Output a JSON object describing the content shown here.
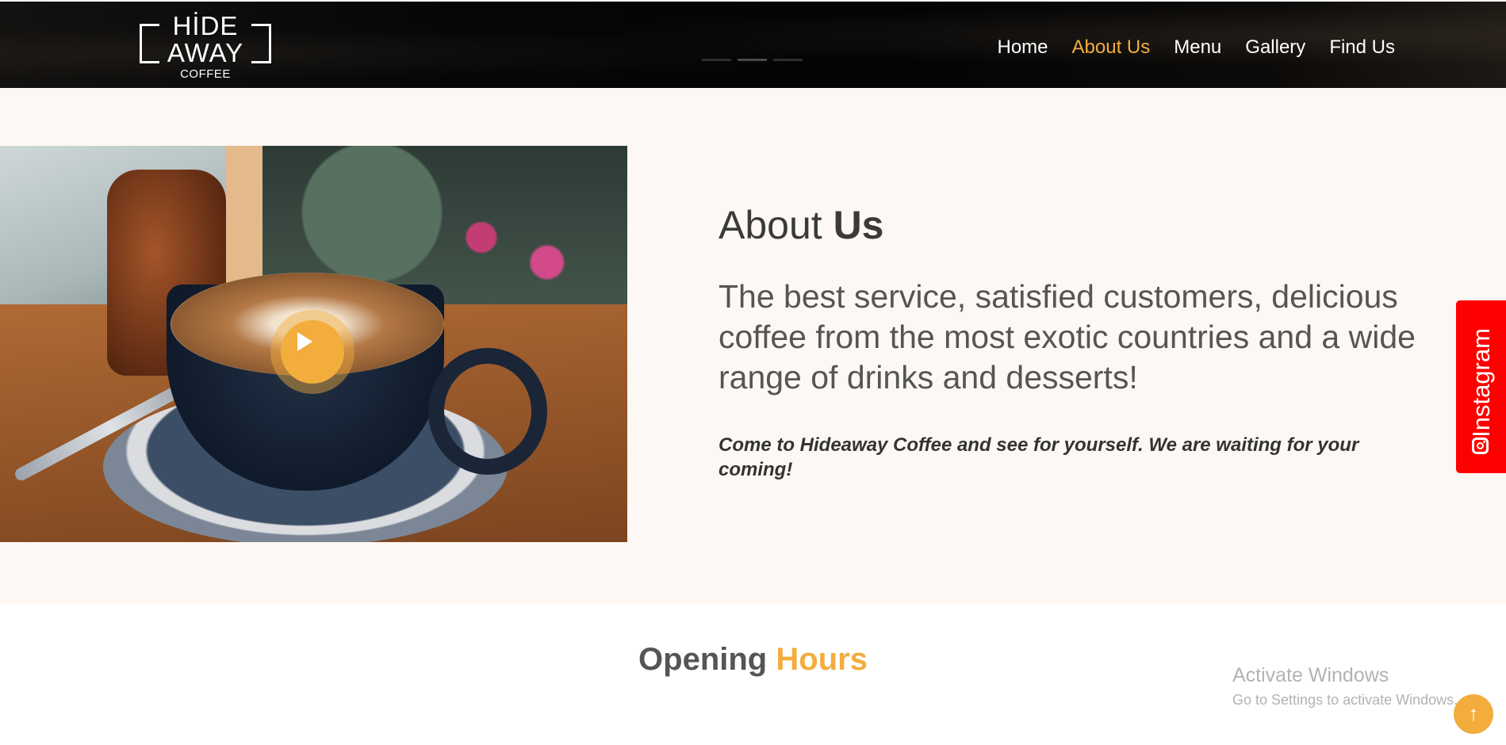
{
  "header": {
    "logo": {
      "line1": "HİDE",
      "line2": "AWAY",
      "line3": "COFFEE"
    },
    "nav": [
      {
        "label": "Home",
        "active": false
      },
      {
        "label": "About Us",
        "active": true
      },
      {
        "label": "Menu",
        "active": false
      },
      {
        "label": "Gallery",
        "active": false
      },
      {
        "label": "Find Us",
        "active": false
      }
    ],
    "slider_indicator": {
      "count": 3,
      "active_index": 1
    }
  },
  "about": {
    "title_light": "About",
    "title_bold": "Us",
    "lead": "The best service, satisfied customers, delicious coffee from the most exotic countries and a wide range of drinks and desserts!",
    "note": "Come to Hideaway Coffee and see for yourself. We are waiting for your coming!",
    "video_button_icon": "play-icon"
  },
  "instagram_tab": {
    "label": "Instagram",
    "icon": "instagram-icon",
    "color": "#ff0000"
  },
  "opening_hours": {
    "title_dark": "Opening",
    "title_accent": "Hours"
  },
  "watermark": {
    "title": "Activate Windows",
    "subtitle": "Go to Settings to activate Windows."
  },
  "scroll_top": {
    "icon": "arrow-up-icon"
  },
  "colors": {
    "accent": "#f2ad3d",
    "header_bg": "#050505",
    "section_bg": "#fdf8f3",
    "instagram": "#ff0000"
  }
}
